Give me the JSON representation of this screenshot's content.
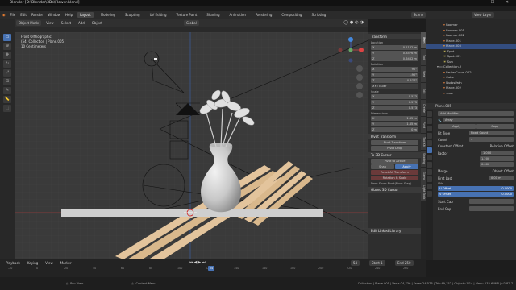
{
  "window": {
    "title": "Blender [D:\\Blender\\3Ds\\Flower.blend]",
    "controls": "– ☐ ✕"
  },
  "menu": {
    "items": [
      "File",
      "Edit",
      "Render",
      "Window",
      "Help"
    ],
    "workspaces": [
      "Layout",
      "Modeling",
      "Sculpting",
      "UV Editing",
      "Texture Paint",
      "Shading",
      "Animation",
      "Rendering",
      "Compositing",
      "Scripting"
    ],
    "active_workspace": "Layout",
    "scene": "Scene",
    "view_layer": "View Layer"
  },
  "viewport_header": {
    "mode": "Object Mode",
    "menus": [
      "View",
      "Select",
      "Add",
      "Object"
    ],
    "transform_orientation": "Global"
  },
  "viewport_info": {
    "line1": "Front Orthographic",
    "line2": "(54) Collection | Plane.005",
    "line3": "10 Centimeters"
  },
  "toolbar": {
    "tools": [
      "select-box",
      "cursor",
      "move",
      "rotate",
      "scale",
      "transform",
      "annotate",
      "measure",
      "add-cube"
    ]
  },
  "npanel": {
    "transform_title": "Transform",
    "location_label": "Location",
    "location": [
      {
        "axis": "X",
        "value": "0.1182 m"
      },
      {
        "axis": "Y",
        "value": "0.8576 m"
      },
      {
        "axis": "Z",
        "value": "0.6482 m"
      }
    ],
    "rotation_label": "Rotation",
    "rotation": [
      {
        "axis": "X",
        "value": "90°"
      },
      {
        "axis": "Y",
        "value": "-90°"
      },
      {
        "axis": "Z",
        "value": "0.577°"
      }
    ],
    "mode_label": "XYZ Euler",
    "scale_label": "Scale",
    "scale": [
      {
        "axis": "X",
        "value": "0.573"
      },
      {
        "axis": "Y",
        "value": "0.573"
      },
      {
        "axis": "Z",
        "value": "0.573"
      }
    ],
    "dimensions_label": "Dimensions",
    "dimensions": [
      {
        "axis": "X",
        "value": "1.65 m"
      },
      {
        "axis": "Y",
        "value": "1.65 m"
      },
      {
        "axis": "Z",
        "value": "0 m"
      }
    ],
    "pivot_title": "Pivot Transform",
    "pivot_buttons": [
      "Pivot Transform",
      "Pivot Drop"
    ],
    "to3d_title": "To 3D Cursor",
    "to3d_buttons": [
      "Pivot to Active",
      "Snap",
      "Apply",
      "Reset All Transform",
      "Rotation & Scale"
    ],
    "dont_show": "Dont Show Pivot(Pivot Step)",
    "gizmo_title": "Gizmo 3D Cursor",
    "edit_linked": "Edit Linked Library",
    "tabs": [
      "Item",
      "Tool",
      "View",
      "Edit",
      "Create",
      "Pivot",
      "Tool Kit",
      "Shading",
      "Gizmo",
      "Light Tools"
    ],
    "active_tab": "Item"
  },
  "outliner": {
    "items": [
      {
        "name": "Roomer",
        "depth": 1
      },
      {
        "name": "Roomer.001",
        "depth": 1
      },
      {
        "name": "Roomer.002",
        "depth": 1
      },
      {
        "name": "Plane.001",
        "depth": 1
      },
      {
        "name": "Plane.005",
        "depth": 1,
        "selected": true
      },
      {
        "name": "Spot",
        "depth": 1
      },
      {
        "name": "Spot.001",
        "depth": 1
      },
      {
        "name": "Sun",
        "depth": 1
      },
      {
        "name": "Collection.2",
        "depth": 0
      },
      {
        "name": "BezierCurve.002",
        "depth": 1
      },
      {
        "name": "Cube",
        "depth": 1
      },
      {
        "name": "NurbsPath",
        "depth": 1
      },
      {
        "name": "Plane.002",
        "depth": 1
      },
      {
        "name": "vase",
        "depth": 1
      }
    ]
  },
  "properties": {
    "object_name": "Plane.005",
    "modifier_button": "Add Modifier",
    "modifier_name": "Array",
    "apply_label": "Apply",
    "copy_label": "Copy",
    "fit_type_label": "Fit Type",
    "fit_type_value": "Fixed Count",
    "count_label": "Count",
    "count_value": "4",
    "constant_offset": "Constant Offset",
    "relative_offset": "Relative Offset",
    "factor_label": "Factor",
    "factors": [
      "1.000",
      "1.200",
      "0.000"
    ],
    "merge": "Merge",
    "object_offset": "Object Offset",
    "first_last": "First Last",
    "distance": "0.01 m",
    "uvs_label": "UVs",
    "u_offset": "U Offset",
    "u_value": "0.0000",
    "v_offset": "V Offset",
    "v_value": "0.0000",
    "start_cap": "Start Cap",
    "end_cap": "End Cap"
  },
  "timeline": {
    "menus": [
      "Playback",
      "Keying",
      "View",
      "Marker"
    ],
    "current_frame": "54",
    "start_label": "Start",
    "start": "1",
    "end_label": "End",
    "end": "250",
    "ticks": [
      "-20",
      "0",
      "20",
      "40",
      "60",
      "80",
      "100",
      "120",
      "140",
      "160",
      "180",
      "200",
      "220",
      "240",
      "260"
    ]
  },
  "statusbar": {
    "left": "Pan View",
    "middle": "Context Menu",
    "right": "Collection | Plane.005 | Verts:24,736 | Faces:24,576 | Tris:49,152 | Objects:1/14 | Mem: 133.6 MiB | v2.82.7"
  },
  "colors": {
    "accent": "#4772b3",
    "viewport": "#3a3a3a",
    "grid": "#444444",
    "wood": "#e0c09a",
    "selection": "#ffa030"
  }
}
